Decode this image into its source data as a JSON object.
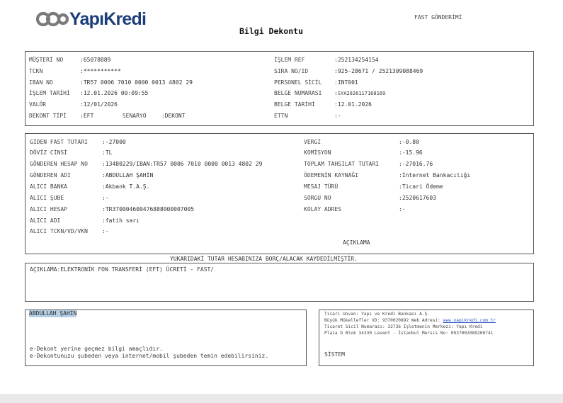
{
  "header": {
    "logo_text": "YapıKredi",
    "doc_type": "FAST GÖNDERİMİ",
    "title": "Bilgi Dekontu"
  },
  "section1": {
    "left": [
      {
        "label": "MÜŞTERİ NO",
        "value": "65078889"
      },
      {
        "label": "TCKN",
        "value": "***********"
      },
      {
        "label": "IBAN NO",
        "value": "TR57 0006 7010 0000 0013 4802 29"
      },
      {
        "label": "İŞLEM TARİHİ",
        "value": "12.01.2026 00:09:55"
      },
      {
        "label": "VALÖR",
        "value": "12/01/2026"
      },
      {
        "label": "DEKONT TİPİ",
        "value": "EFT",
        "label2": "SENARYO",
        "value2": "DEKONT"
      }
    ],
    "right": [
      {
        "label": "İŞLEM REF",
        "value": "252134254154"
      },
      {
        "label": "SIRA NO/ID",
        "value": "925-28671 / 2521309088469"
      },
      {
        "label": "PERSONEL SİCİL",
        "value": "INT001"
      },
      {
        "label": "BELGE NUMARASI",
        "value": "SYA2026117160169"
      },
      {
        "label": "BELGE TARİHİ",
        "value": "12.01.2026"
      },
      {
        "label": "ETTN",
        "value": "-"
      }
    ]
  },
  "section2": {
    "left": [
      {
        "label": "GİDEN FAST TUTARI",
        "value": "-27000"
      },
      {
        "label": "DÖVİZ CİNSİ",
        "value": "TL"
      },
      {
        "label": "GÖNDEREN HESAP NO",
        "value": "13480229/IBAN:TR57 0006 7010 0000 0013 4802 29"
      },
      {
        "label": "GÖNDEREN ADI",
        "value": "ABDULLAH ŞAHİN"
      },
      {
        "label": "ALICI BANKA",
        "value": "Akbank T.A.Ş."
      },
      {
        "label": "ALICI ŞUBE",
        "value": "-"
      },
      {
        "label": "ALICI HESAP",
        "value": "TR370004600476888000007005"
      },
      {
        "label": "ALICI ADI",
        "value": "fatih sarı"
      },
      {
        "label": "ALICI TCKN/VD/VKN",
        "value": "-"
      }
    ],
    "right": [
      {
        "label": "VERGİ",
        "value": "-0.80"
      },
      {
        "label": "KOMİSYON",
        "value": "-15.96"
      },
      {
        "label": "TOPLAM TAHSILAT TUTARI",
        "value": "-27016.76"
      },
      {
        "label": "ÖDEMENİN KAYNAĞI",
        "value": "İnternet Bankacılığı"
      },
      {
        "label": "MESAJ TÜRÜ",
        "value": "Ticari Ödeme"
      },
      {
        "label": "SORGU NO",
        "value": "2520617603"
      },
      {
        "label": "KOLAY ADRES",
        "value": "-"
      }
    ],
    "aciklama_heading": "AÇIKLAMA"
  },
  "notice": "YUKARIDAKİ TUTAR HESABINIZA BORÇ/ALACAK KAYDEDİLMİŞTİR.",
  "description": "AÇIKLAMA:ELEKTRONİK FON TRANSFERİ (EFT) ÜCRETİ - FAST/",
  "footer_left": {
    "name": "ABDULLAH ŞAHİN",
    "line1": "e-Dekont yerine geçmez bilgi amaçlıdır.",
    "line2": "e-Dekontunuzu şubeden veya internet/mobil şubeden temin edebilirsiniz."
  },
  "footer_right": {
    "line1": "Ticari Unvan: Yapı ve Kredi Bankası A.Ş.",
    "line2_prefix": "Büyük Mükellefler VD: 9370020892 Web Adresi: ",
    "line2_link": "www.yapikredi.com.tr",
    "line3": "Ticaret Sicil Numarası: 32736 İşletmenin Merkezi: Yapı Kredi",
    "line4": "Plaza D Blok 34330 Levent - İstanbul Mersis No: 0937002089200741",
    "system": "SİSTEM"
  },
  "colors": {
    "brand": "#1c3f7a",
    "highlight": "#b5cfe6",
    "link": "#2a54c8"
  }
}
